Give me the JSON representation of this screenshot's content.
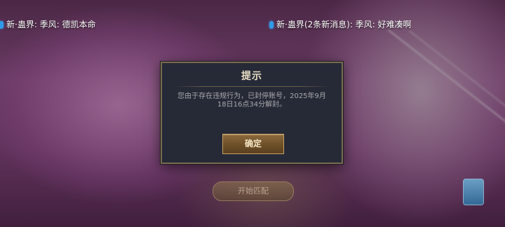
{
  "chat": {
    "left": "新·蛊界: 季风: 德凯本命",
    "right": "新·蛊界(2条新消息): 季风: 好难凑啊"
  },
  "background": {
    "button_label": "开始匹配"
  },
  "dialog": {
    "title": "提示",
    "message": "您由于存在违规行为，已封停账号，2025年9月18日16点34分解封。",
    "confirm_label": "确定"
  },
  "colors": {
    "dialog_bg": "#262a37",
    "dialog_border": "#7a6b4e",
    "title": "#e9dfc6",
    "message": "#a9a9ab",
    "button": "#6d4f28",
    "chat_icon": "#2f9be8"
  },
  "icons": {
    "chat": "chat-bubble-icon"
  }
}
